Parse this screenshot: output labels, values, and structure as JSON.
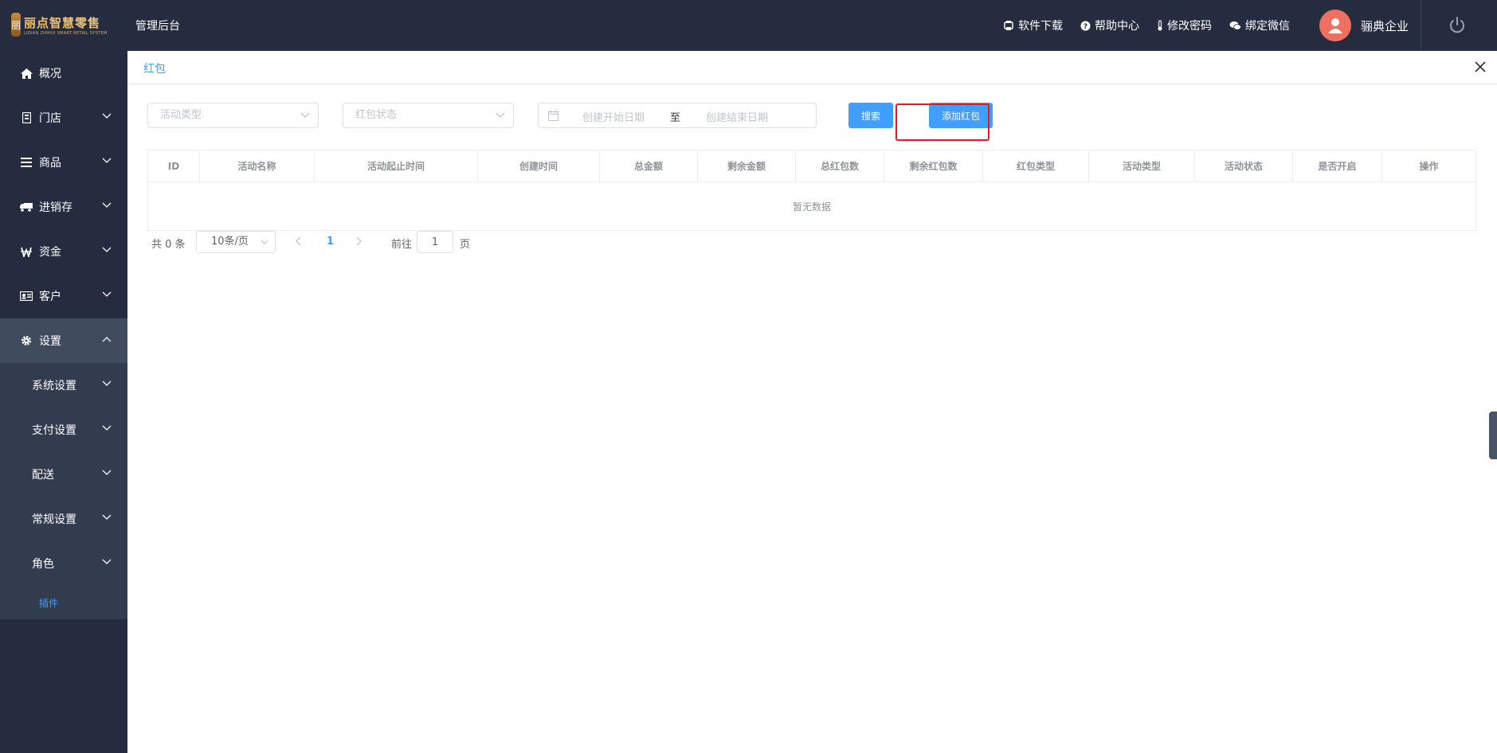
{
  "header": {
    "logo_badge": "丽",
    "logo_main": "丽点智慧零售",
    "logo_sub": "LIDIAN ZHIHUI SMART RETAIL SYSTEM",
    "admin_title": "管理后台",
    "links": [
      "软件下载",
      "帮助中心",
      "修改密码",
      "绑定微信"
    ],
    "company": "骊典企业"
  },
  "sidebar": {
    "items": [
      {
        "label": "概况",
        "icon": "home-icon"
      },
      {
        "label": "门店",
        "icon": "store-icon"
      },
      {
        "label": "商品",
        "icon": "list-icon"
      },
      {
        "label": "进销存",
        "icon": "truck-icon"
      },
      {
        "label": "资金",
        "icon": "won-icon"
      },
      {
        "label": "客户",
        "icon": "id-card-icon"
      },
      {
        "label": "设置",
        "icon": "gear-icon"
      }
    ],
    "settings_sub": [
      "系统设置",
      "支付设置",
      "配送",
      "常规设置",
      "角色"
    ],
    "active_leaf": "插件"
  },
  "tab": {
    "title": "红包"
  },
  "filters": {
    "activity_type_placeholder": "活动类型",
    "redpacket_status_placeholder": "红包状态",
    "start_date_placeholder": "创建开始日期",
    "date_separator": "至",
    "end_date_placeholder": "创建结束日期",
    "search_label": "搜索",
    "add_label": "添加红包"
  },
  "table": {
    "columns": [
      "ID",
      "活动名称",
      "活动起止时间",
      "创建时间",
      "总金额",
      "剩余金额",
      "总红包数",
      "剩余红包数",
      "红包类型",
      "活动类型",
      "活动状态",
      "是否开启",
      "操作"
    ],
    "empty_text": "暂无数据"
  },
  "pagination": {
    "total_text": "共 0 条",
    "page_size": "10条/页",
    "current_page": "1",
    "goto_label": "前往",
    "goto_value": "1",
    "page_unit": "页"
  },
  "colors": {
    "primary": "#409eff",
    "sidebar_bg": "#252c40",
    "highlight": "#e8191e"
  }
}
